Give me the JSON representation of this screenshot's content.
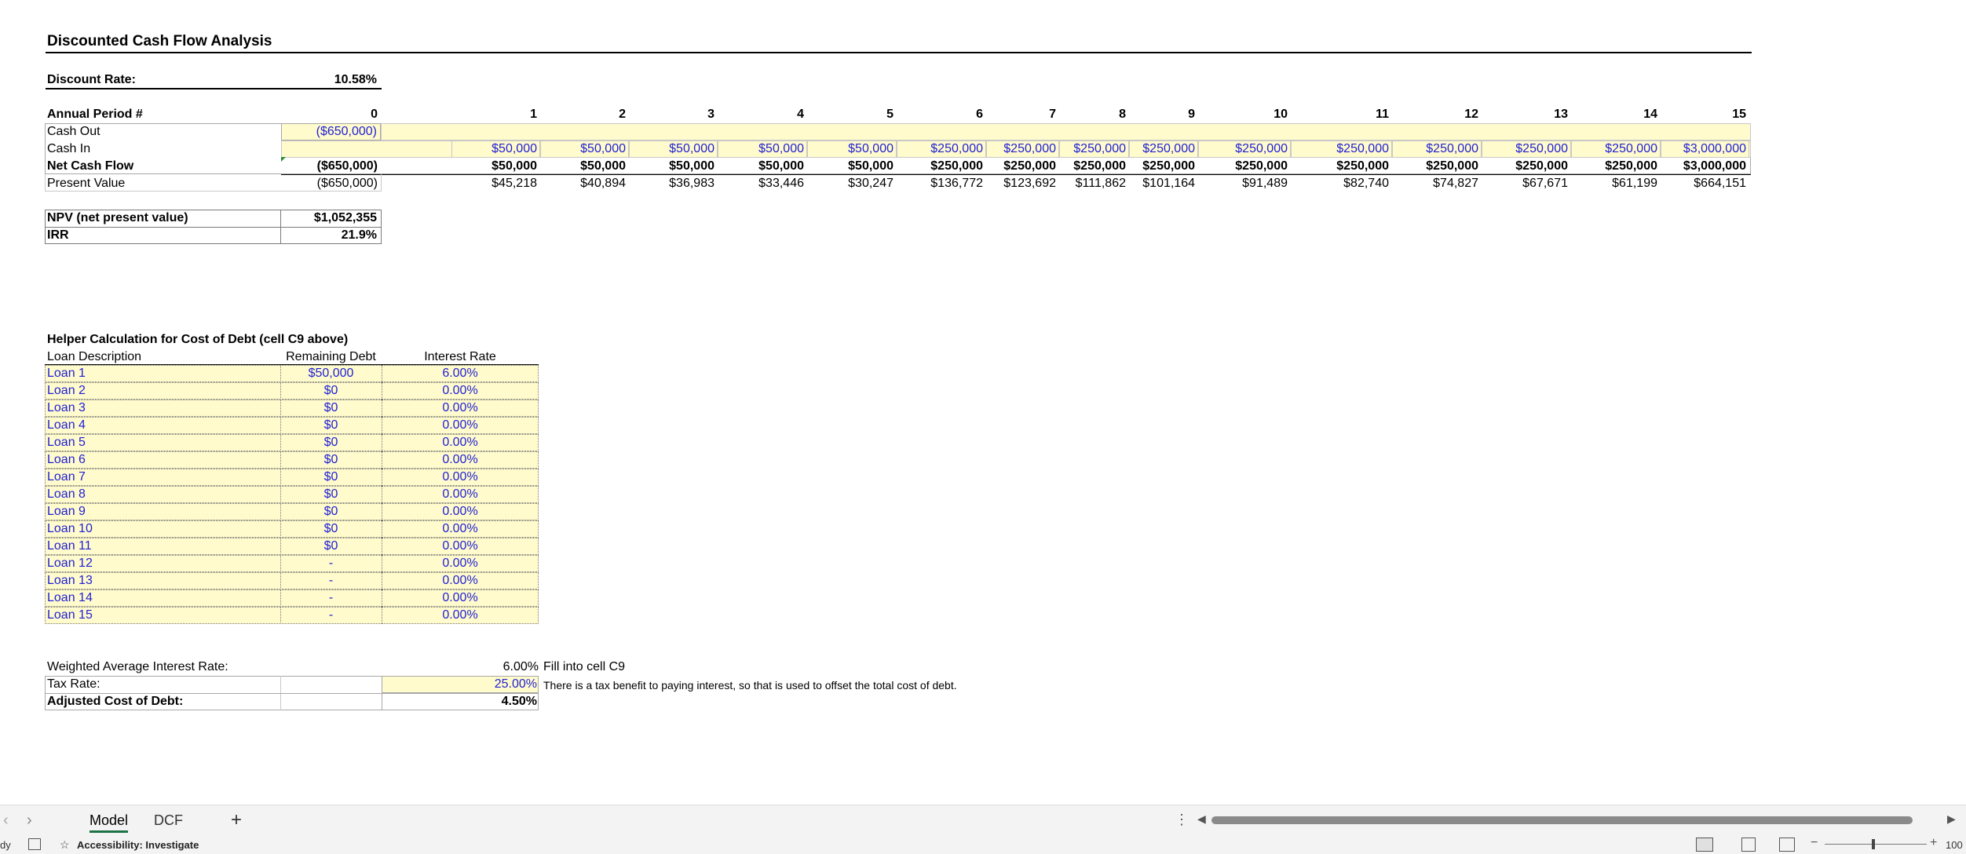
{
  "title": "Discounted Cash Flow Analysis",
  "discount": {
    "label": "Discount Rate:",
    "value": "10.58%"
  },
  "periods": {
    "label": "Annual Period #",
    "values": [
      "0",
      "1",
      "2",
      "3",
      "4",
      "5",
      "6",
      "7",
      "8",
      "9",
      "10",
      "11",
      "12",
      "13",
      "14",
      "15"
    ]
  },
  "rows": {
    "cash_out": {
      "label": "Cash Out",
      "p0": "($650,000)"
    },
    "cash_in": {
      "label": "Cash In",
      "values": [
        "$50,000",
        "$50,000",
        "$50,000",
        "$50,000",
        "$50,000",
        "$250,000",
        "$250,000",
        "$250,000",
        "$250,000",
        "$250,000",
        "$250,000",
        "$250,000",
        "$250,000",
        "$250,000",
        "$3,000,000"
      ]
    },
    "net": {
      "label": "Net Cash Flow",
      "values": [
        "($650,000)",
        "$50,000",
        "$50,000",
        "$50,000",
        "$50,000",
        "$50,000",
        "$250,000",
        "$250,000",
        "$250,000",
        "$250,000",
        "$250,000",
        "$250,000",
        "$250,000",
        "$250,000",
        "$250,000",
        "$3,000,000"
      ]
    },
    "pv": {
      "label": "Present Value",
      "values": [
        "($650,000)",
        "$45,218",
        "$40,894",
        "$36,983",
        "$33,446",
        "$30,247",
        "$136,772",
        "$123,692",
        "$111,862",
        "$101,164",
        "$91,489",
        "$82,740",
        "$74,827",
        "$67,671",
        "$61,199",
        "$664,151"
      ]
    }
  },
  "summary": {
    "npv_label": "NPV (net present value)",
    "npv_value": "$1,052,355",
    "irr_label": "IRR",
    "irr_value": "21.9%"
  },
  "helper": {
    "title": "Helper Calculation for Cost of Debt (cell C9 above)",
    "col_desc": "Loan Description",
    "col_debt": "Remaining Debt",
    "col_rate": "Interest Rate",
    "loans": [
      {
        "name": "Loan 1",
        "debt": "$50,000",
        "rate": "6.00%"
      },
      {
        "name": "Loan 2",
        "debt": "$0",
        "rate": "0.00%"
      },
      {
        "name": "Loan 3",
        "debt": "$0",
        "rate": "0.00%"
      },
      {
        "name": "Loan 4",
        "debt": "$0",
        "rate": "0.00%"
      },
      {
        "name": "Loan 5",
        "debt": "$0",
        "rate": "0.00%"
      },
      {
        "name": "Loan 6",
        "debt": "$0",
        "rate": "0.00%"
      },
      {
        "name": "Loan 7",
        "debt": "$0",
        "rate": "0.00%"
      },
      {
        "name": "Loan 8",
        "debt": "$0",
        "rate": "0.00%"
      },
      {
        "name": "Loan 9",
        "debt": "$0",
        "rate": "0.00%"
      },
      {
        "name": "Loan 10",
        "debt": "$0",
        "rate": "0.00%"
      },
      {
        "name": "Loan 11",
        "debt": "$0",
        "rate": "0.00%"
      },
      {
        "name": "Loan 12",
        "debt": "-",
        "rate": "0.00%"
      },
      {
        "name": "Loan 13",
        "debt": "-",
        "rate": "0.00%"
      },
      {
        "name": "Loan 14",
        "debt": "-",
        "rate": "0.00%"
      },
      {
        "name": "Loan 15",
        "debt": "-",
        "rate": "0.00%"
      }
    ]
  },
  "debt_summary": {
    "wair_label": "Weighted Average Interest Rate:",
    "wair_value": "6.00%",
    "wair_note": "Fill into cell C9",
    "tax_label": "Tax Rate:",
    "tax_value": "25.00%",
    "tax_note": "There is a tax benefit to paying interest, so that is used to offset the total cost of debt.",
    "adj_label": "Adjusted Cost of Debt:",
    "adj_value": "4.50%"
  },
  "tabs": {
    "active": "Model",
    "other": "DCF",
    "add": "+"
  },
  "status": {
    "ready": "dy",
    "accessibility": "Accessibility: Investigate",
    "zoom": "100"
  },
  "colors": {
    "input_fill": "#fffbcc",
    "input_text": "#1f1fd6",
    "active_tab": "#1e7145"
  }
}
